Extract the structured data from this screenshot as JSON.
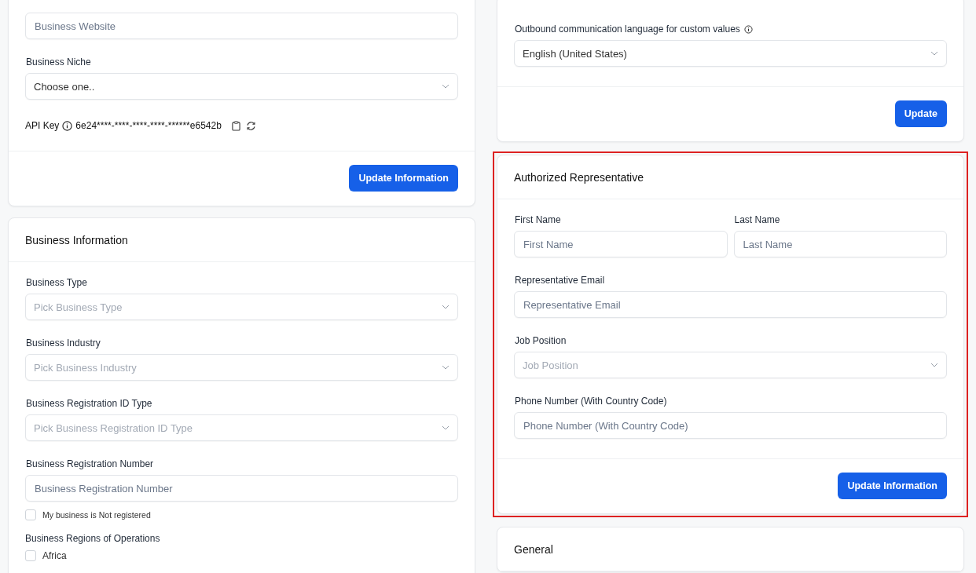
{
  "columns": [
    {
      "cards": [
        {
          "rows": [
            [
              {
                "kind": "input",
                "placeholder": "Business Website"
              }
            ],
            [
              {
                "kind": "select",
                "label": "Business Niche",
                "value": "Choose one.."
              }
            ]
          ],
          "api_key": {
            "label": "API Key",
            "value": "6e24****-****-****-****-******e6542b"
          },
          "button": "Update Information"
        },
        {
          "title": "Business Information",
          "rows": [
            [
              {
                "kind": "select",
                "label": "Business Type",
                "placeholder": "Pick Business Type"
              }
            ],
            [
              {
                "kind": "select",
                "label": "Business Industry",
                "placeholder": "Pick Business Industry"
              }
            ],
            [
              {
                "kind": "select",
                "label": "Business Registration ID Type",
                "placeholder": "Pick Business Registration ID Type"
              }
            ],
            [
              {
                "kind": "input",
                "label": "Business Registration Number",
                "placeholder": "Business Registration Number"
              }
            ]
          ],
          "checkbox": {
            "label": "My business is Not registered",
            "checked": false
          },
          "checklist": {
            "label": "Business Regions of Operations",
            "options": [
              {
                "label": "Africa",
                "checked": false
              }
            ]
          }
        }
      ]
    },
    {
      "cards": [
        {
          "rows": [
            [
              {
                "kind": "select",
                "label": "Outbound communication language for custom values",
                "info": true,
                "value": "English (United States)"
              }
            ]
          ],
          "button": "Update"
        },
        {
          "title": "Authorized Representative",
          "highlighted": true,
          "rows": [
            [
              {
                "kind": "input",
                "label": "First Name",
                "placeholder": "First Name"
              },
              {
                "kind": "input",
                "label": "Last Name",
                "placeholder": "Last Name"
              }
            ],
            [
              {
                "kind": "input",
                "label": "Representative Email",
                "placeholder": "Representative Email"
              }
            ],
            [
              {
                "kind": "select",
                "label": "Job Position",
                "placeholder": "Job Position"
              }
            ],
            [
              {
                "kind": "input",
                "label": "Phone Number (With Country Code)",
                "placeholder": "Phone Number (With Country Code)"
              }
            ]
          ],
          "button": "Update Information"
        },
        {
          "title": "General"
        }
      ]
    }
  ]
}
